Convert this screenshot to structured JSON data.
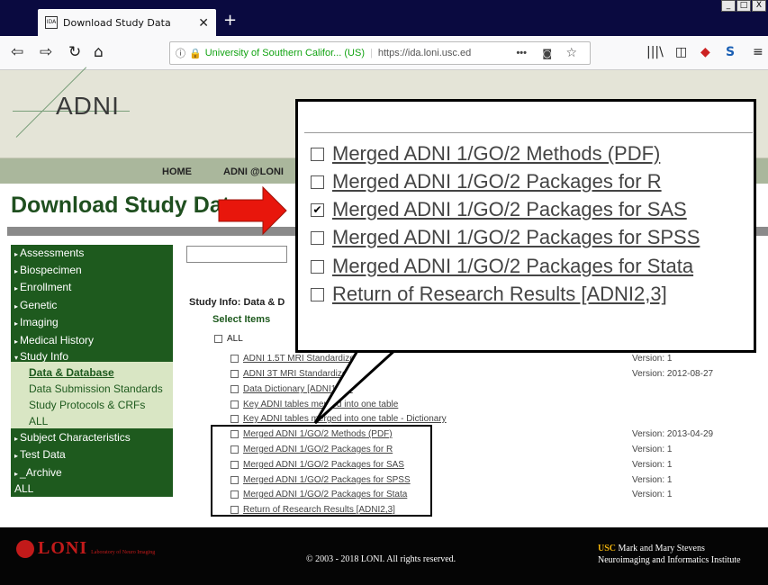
{
  "browser": {
    "tab_title": "Download Study Data",
    "tab_favicon": "IDA",
    "close_glyph": "✕",
    "newtab_glyph": "+",
    "url_org": "University of Southern Califor... (US)",
    "url": "https://ida.loni.usc.ed",
    "more_glyph": "•••",
    "window_controls": [
      "_",
      "□",
      "X"
    ]
  },
  "site": {
    "logo_text": "ADNI",
    "nav": [
      "HOME",
      "ADNI @LONI"
    ],
    "page_title": "Download Study Data"
  },
  "sidebar": {
    "items": [
      "Assessments",
      "Biospecimen",
      "Enrollment",
      "Genetic",
      "Imaging",
      "Medical History",
      "Study Info"
    ],
    "sub_items": [
      "Data & Database",
      "Data Submission Standards",
      "Study Protocols & CRFs",
      "ALL"
    ],
    "items_after": [
      "Subject Characteristics",
      "Test Data",
      "_Archive",
      "ALL"
    ]
  },
  "content": {
    "study_info_label": "Study Info: Data & D",
    "select_items_label": "Select Items",
    "all_label": "ALL",
    "items": [
      {
        "label": "ADNI 1.5T MRI Standardized L",
        "version": "Version: 1"
      },
      {
        "label": "ADNI 3T MRI Standardized L",
        "version": "Version: 2012-08-27"
      },
      {
        "label": "Data Dictionary [ADNI1,GO",
        "version": ""
      },
      {
        "label": "Key ADNI tables merged into one table",
        "version": ""
      },
      {
        "label": "Key ADNI tables merged into one table - Dictionary",
        "version": ""
      },
      {
        "label": "Merged ADNI 1/GO/2 Methods (PDF)",
        "version": "Version: 2013-04-29"
      },
      {
        "label": "Merged ADNI 1/GO/2 Packages for R",
        "version": "Version: 1"
      },
      {
        "label": "Merged ADNI 1/GO/2 Packages for SAS",
        "version": "Version: 1"
      },
      {
        "label": "Merged ADNI 1/GO/2 Packages for SPSS",
        "version": "Version: 1"
      },
      {
        "label": "Merged ADNI 1/GO/2 Packages for Stata",
        "version": "Version: 1"
      },
      {
        "label": "Return of Research Results [ADNI2,3]",
        "version": ""
      }
    ]
  },
  "callout": {
    "items": [
      {
        "label": "Merged ADNI 1/GO/2 Methods (PDF)",
        "checked": false
      },
      {
        "label": "Merged ADNI 1/GO/2 Packages for R",
        "checked": false
      },
      {
        "label": "Merged ADNI 1/GO/2 Packages for SAS",
        "checked": true
      },
      {
        "label": "Merged ADNI 1/GO/2 Packages for SPSS",
        "checked": false
      },
      {
        "label": "Merged ADNI 1/GO/2 Packages for Stata",
        "checked": false
      },
      {
        "label": "Return of Research Results [ADNI2,3]",
        "checked": false
      }
    ],
    "check_glyph": "✔"
  },
  "footer": {
    "loni_word": "LONI",
    "loni_sub": "Laboratory of Neuro Imaging",
    "copyright": "© 2003 - 2018 LONI. All rights reserved.",
    "usc": "USC",
    "usc_line1": "Mark and Mary Stevens",
    "usc_line2": "Neuroimaging and Informatics Institute"
  },
  "colors": {
    "sidebar_bg": "#1e5a1e",
    "sidebar_sub_bg": "#d9e6c4",
    "arrow_red": "#e8160c",
    "loni_red": "#c21a1a",
    "usc_gold": "#f0b30c"
  }
}
